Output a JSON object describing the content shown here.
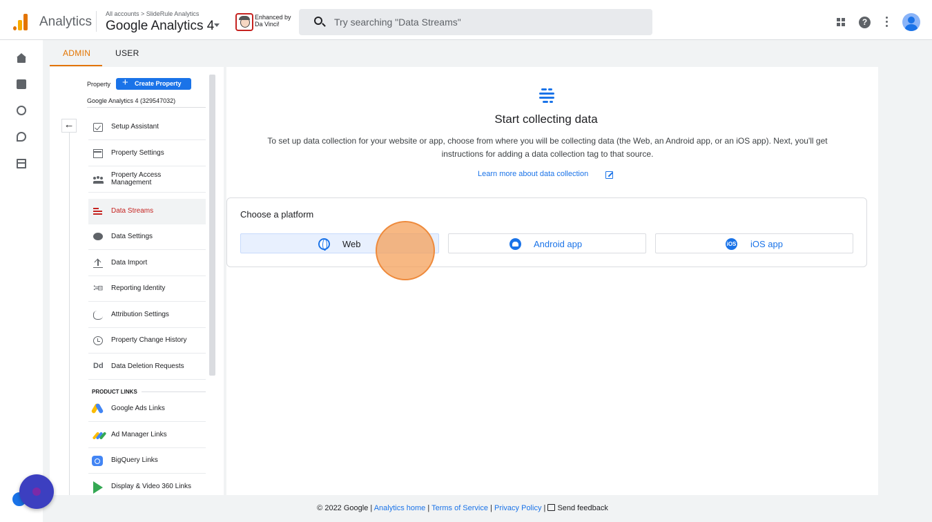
{
  "header": {
    "app_name": "Analytics",
    "breadcrumb": "All accounts > SlideRule Analytics",
    "property_title": "Google Analytics 4",
    "extension_badge": "Enhanced by\nDa Vinci!",
    "search_placeholder": "Try searching \"Data Streams\"",
    "help_glyph": "?"
  },
  "tabs": [
    {
      "label": "ADMIN",
      "active": true
    },
    {
      "label": "USER",
      "active": false
    }
  ],
  "property_panel": {
    "property_label": "Property",
    "create_button": "Create Property",
    "property_name": "Google Analytics 4 (329547032)",
    "back_glyph": "←",
    "items": [
      {
        "label": "Setup Assistant",
        "icon": "checklist-icon"
      },
      {
        "label": "Property Settings",
        "icon": "property-settings-icon"
      },
      {
        "label": "Property Access Management",
        "icon": "people-icon"
      },
      {
        "label": "Data Streams",
        "icon": "data-streams-icon",
        "active": true
      },
      {
        "label": "Data Settings",
        "icon": "database-icon"
      },
      {
        "label": "Data Import",
        "icon": "upload-icon"
      },
      {
        "label": "Reporting Identity",
        "icon": "reporting-identity-icon",
        "glyph": "⁚≡⊟"
      },
      {
        "label": "Attribution Settings",
        "icon": "attribution-icon"
      },
      {
        "label": "Property Change History",
        "icon": "history-icon"
      },
      {
        "label": "Data Deletion Requests",
        "icon": "data-deletion-icon",
        "glyph": "Dd"
      }
    ],
    "product_links_heading": "PRODUCT LINKS",
    "product_links": [
      {
        "label": "Google Ads Links",
        "icon": "google-ads-icon"
      },
      {
        "label": "Ad Manager Links",
        "icon": "ad-manager-icon"
      },
      {
        "label": "BigQuery Links",
        "icon": "bigquery-icon"
      },
      {
        "label": "Display & Video 360 Links",
        "icon": "display-video-360-icon"
      }
    ]
  },
  "main": {
    "title": "Start collecting data",
    "description": "To set up data collection for your website or app, choose from where you will be collecting data (the Web, an Android app, or an iOS app). Next, you'll get instructions for adding a data collection tag to that source.",
    "learn_more": "Learn more about data collection",
    "platform_heading": "Choose a platform",
    "platforms": [
      {
        "label": "Web",
        "icon": "globe-icon",
        "selected": true
      },
      {
        "label": "Android app",
        "icon": "android-icon",
        "selected": false
      },
      {
        "label": "iOS app",
        "icon": "ios-icon",
        "glyph": "iOS",
        "selected": false
      }
    ]
  },
  "footer": {
    "copyright": "© 2022 Google |",
    "analytics_home": "Analytics home",
    "sep1": "|",
    "terms": "Terms of Service",
    "sep2": "|",
    "privacy": "Privacy Policy",
    "sep3": "|",
    "feedback": "Send feedback"
  },
  "colors": {
    "accent": "#e37400",
    "brand_blue": "#1a73e8",
    "active_item": "#c5221f",
    "click_marker": "#f4a05a"
  }
}
